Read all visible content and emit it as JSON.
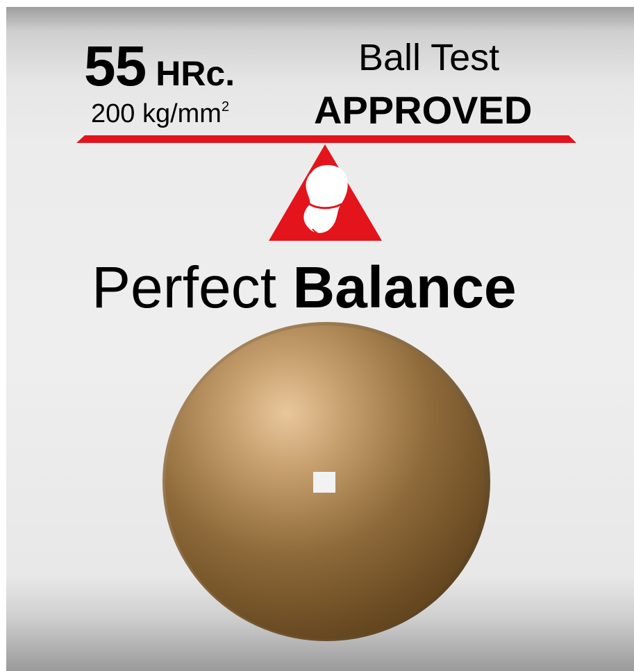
{
  "hardness": {
    "value": "55",
    "unit": "HRc.",
    "strength": "200 kg/mm",
    "strength_exponent": "2"
  },
  "ball_test": {
    "label": "Ball Test",
    "status": "APPROVED"
  },
  "headline": {
    "normal": "Perfect",
    "bold": "Balance"
  },
  "colors": {
    "accent_red": "#e3141c",
    "disc_bronze": "#7a5a30",
    "background_gray": "#ececec"
  },
  "icons": {
    "balance_logo": "triangle-ball-icon",
    "product": "square-hole-disc-icon"
  }
}
